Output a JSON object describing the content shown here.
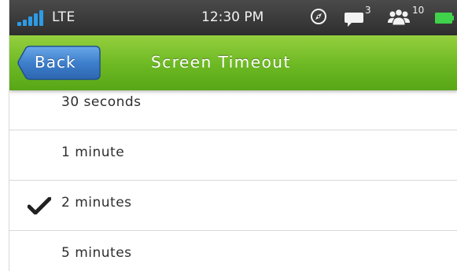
{
  "status_bar": {
    "network": "LTE",
    "time": "12:30 PM",
    "chat_count": "3",
    "people_count": "10",
    "signal_icon": "signal-strength-icon",
    "compass_icon": "compass-icon",
    "chat_icon": "chat-bubble-icon",
    "people_icon": "people-group-icon",
    "battery_icon": "battery-icon",
    "signal_color": "#2d9be6",
    "battery_color": "#3fd24a"
  },
  "header": {
    "back_label": "Back",
    "title": "Screen Timeout",
    "accent_color": "#6cb823"
  },
  "options": [
    {
      "label": "30 seconds",
      "selected": false
    },
    {
      "label": "1 minute",
      "selected": false
    },
    {
      "label": "2 minutes",
      "selected": true
    },
    {
      "label": "5 minutes",
      "selected": false
    }
  ]
}
